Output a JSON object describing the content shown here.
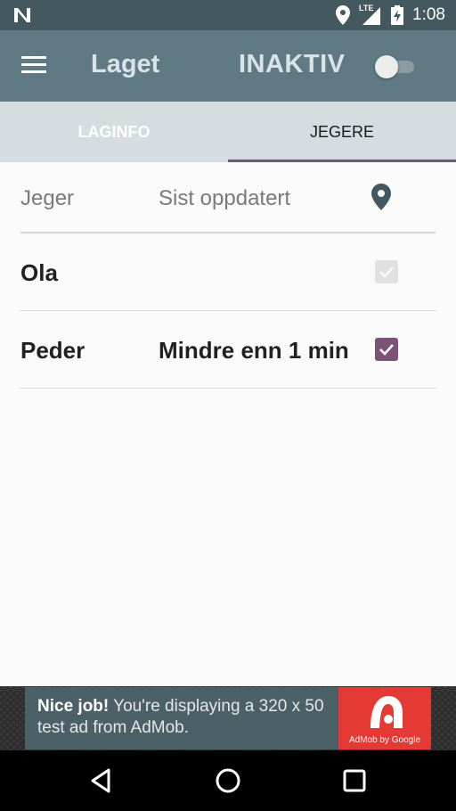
{
  "status_bar": {
    "time": "1:08",
    "network": "LTE",
    "icons": [
      "notification-n-icon",
      "location-icon",
      "signal-icon",
      "battery-charging-icon"
    ]
  },
  "app_bar": {
    "title": "Laget",
    "status_label": "INAKTIV",
    "toggle_on": false,
    "menu_icon": "hamburger-menu-icon"
  },
  "tabs": [
    {
      "label": "LAGINFO",
      "active": false
    },
    {
      "label": "JEGERE",
      "active": true
    }
  ],
  "colors": {
    "accent": "#7b5278",
    "app_bar": "#5f7a84",
    "status_bar": "#43595f",
    "tab_bar": "#d5dde0"
  },
  "table": {
    "header": {
      "name": "Jeger",
      "updated": "Sist oppdatert",
      "location_icon": "map-pin-icon"
    },
    "rows": [
      {
        "name": "Ola",
        "updated": "",
        "checked": true,
        "enabled": false
      },
      {
        "name": "Peder",
        "updated": "Mindre enn 1 min",
        "checked": true,
        "enabled": true
      }
    ]
  },
  "ad": {
    "bold": "Nice job!",
    "text": "You're displaying a 320 x 50 test ad from AdMob.",
    "logo_caption": "AdMob by Google"
  },
  "nav_bar": {
    "buttons": [
      "back-icon",
      "home-icon",
      "recents-icon"
    ]
  }
}
